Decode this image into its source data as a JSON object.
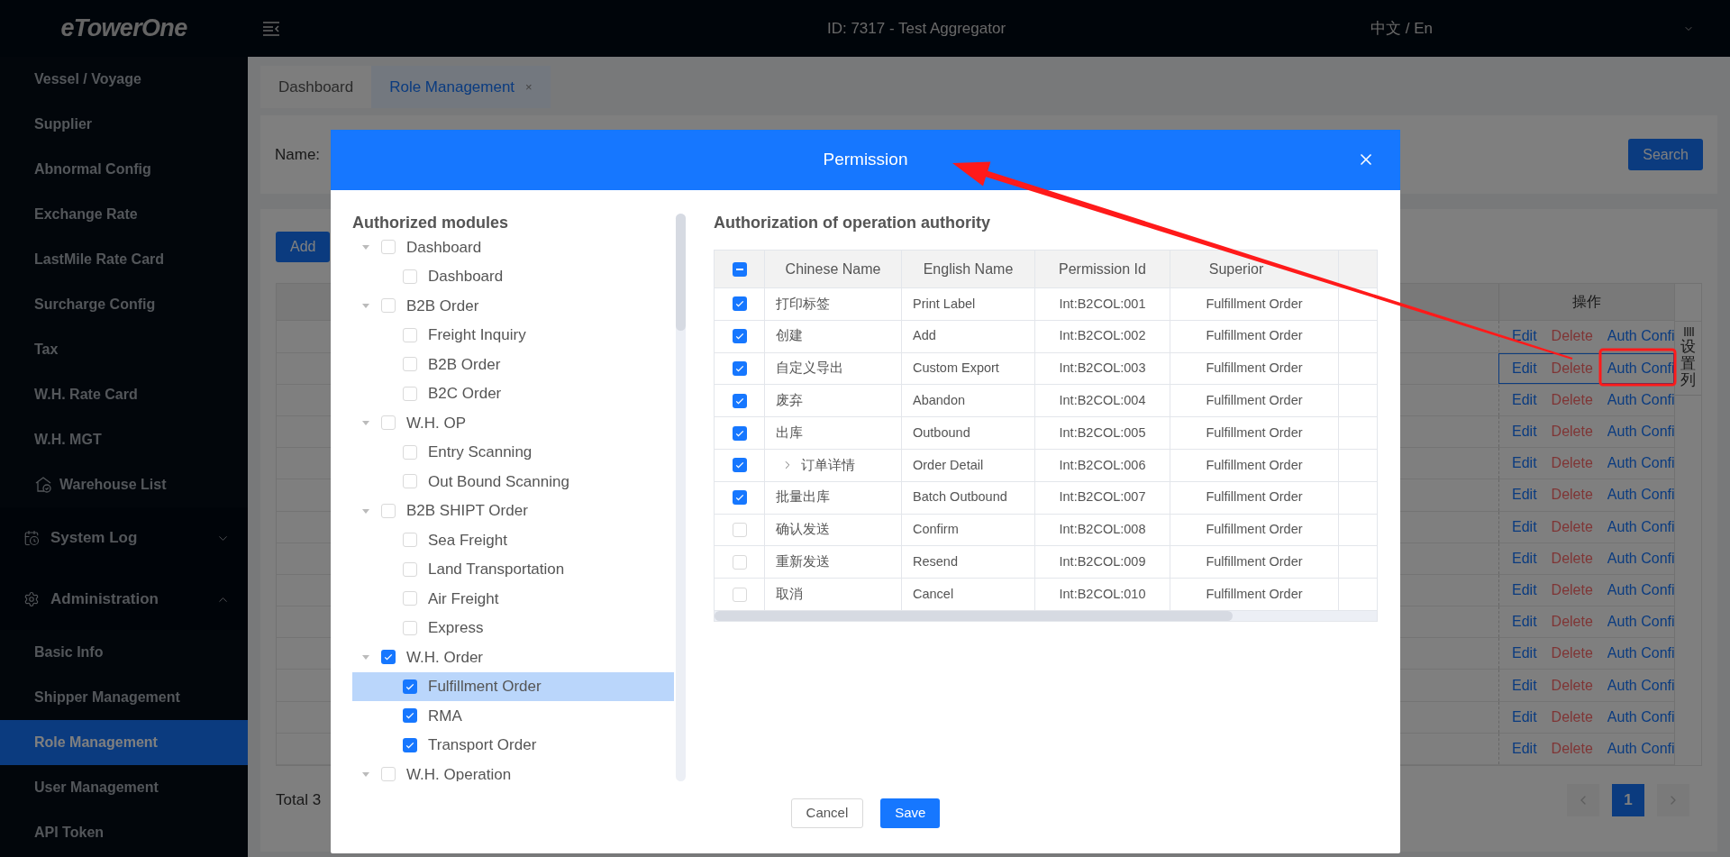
{
  "header": {
    "logo": "eTowerOne",
    "org": "ID: 7317 - Test Aggregator",
    "language": "中文 / En"
  },
  "sidebar": {
    "items": [
      {
        "label": "Vessel / Voyage",
        "kind": "item",
        "selected": false
      },
      {
        "label": "Supplier",
        "kind": "item",
        "selected": false
      },
      {
        "label": "Abnormal Config",
        "kind": "item",
        "selected": false
      },
      {
        "label": "Exchange Rate",
        "kind": "item",
        "selected": false
      },
      {
        "label": "LastMile Rate Card",
        "kind": "item",
        "selected": false
      },
      {
        "label": "Surcharge Config",
        "kind": "item",
        "selected": false
      },
      {
        "label": "Tax",
        "kind": "item",
        "selected": false
      },
      {
        "label": "W.H. Rate Card",
        "kind": "item",
        "selected": false
      },
      {
        "label": "W.H. MGT",
        "kind": "item",
        "selected": false
      },
      {
        "label": "Warehouse List",
        "kind": "icon-item",
        "selected": false
      },
      {
        "label": "System Log",
        "kind": "log-group",
        "expanded": false
      },
      {
        "label": "Administration",
        "kind": "admin-group",
        "expanded": true
      },
      {
        "label": "Basic Info",
        "kind": "item",
        "selected": false
      },
      {
        "label": "Shipper Management",
        "kind": "item",
        "selected": false
      },
      {
        "label": "Role Management",
        "kind": "item",
        "selected": true
      },
      {
        "label": "User Management",
        "kind": "item",
        "selected": false
      },
      {
        "label": "API Token",
        "kind": "item",
        "selected": false
      }
    ]
  },
  "tabs": [
    {
      "label": "Dashboard",
      "selected": false
    },
    {
      "label": "Role Management",
      "selected": true,
      "close": "×"
    }
  ],
  "filter": {
    "label": "Name:",
    "search_button": "Search"
  },
  "list": {
    "add_button": "Add",
    "action_header": "操作",
    "column_settings": "设置列",
    "rows": [
      {
        "highlighted": false,
        "actions": [
          {
            "label": "Edit",
            "kind": "link"
          },
          {
            "label": "Delete",
            "kind": "danger"
          },
          {
            "label": "Auth Confi",
            "kind": "link"
          }
        ]
      },
      {
        "highlighted": true,
        "actions": [
          {
            "label": "Edit",
            "kind": "link"
          },
          {
            "label": "Delete",
            "kind": "danger"
          },
          {
            "label": "Auth Confi",
            "kind": "link"
          }
        ]
      },
      {
        "highlighted": false,
        "actions": [
          {
            "label": "Edit",
            "kind": "link"
          },
          {
            "label": "Delete",
            "kind": "danger"
          },
          {
            "label": "Auth Confi",
            "kind": "link"
          }
        ]
      },
      {
        "highlighted": false,
        "actions": [
          {
            "label": "Edit",
            "kind": "link"
          },
          {
            "label": "Delete",
            "kind": "danger"
          },
          {
            "label": "Auth Confi",
            "kind": "link"
          }
        ]
      },
      {
        "highlighted": false,
        "actions": [
          {
            "label": "Edit",
            "kind": "link"
          },
          {
            "label": "Delete",
            "kind": "danger"
          },
          {
            "label": "Auth Confi",
            "kind": "link"
          }
        ]
      },
      {
        "highlighted": false,
        "actions": [
          {
            "label": "Edit",
            "kind": "link"
          },
          {
            "label": "Delete",
            "kind": "danger"
          },
          {
            "label": "Auth Confi",
            "kind": "link"
          }
        ]
      },
      {
        "highlighted": false,
        "actions": [
          {
            "label": "Edit",
            "kind": "link"
          },
          {
            "label": "Delete",
            "kind": "danger"
          },
          {
            "label": "Auth Confi",
            "kind": "link"
          }
        ]
      },
      {
        "highlighted": false,
        "actions": [
          {
            "label": "Edit",
            "kind": "link"
          },
          {
            "label": "Delete",
            "kind": "danger"
          },
          {
            "label": "Auth Confi",
            "kind": "link"
          }
        ]
      },
      {
        "highlighted": false,
        "actions": [
          {
            "label": "Edit",
            "kind": "link"
          },
          {
            "label": "Delete",
            "kind": "danger"
          },
          {
            "label": "Auth Confi",
            "kind": "link"
          }
        ]
      },
      {
        "highlighted": false,
        "actions": [
          {
            "label": "Edit",
            "kind": "link"
          },
          {
            "label": "Delete",
            "kind": "danger"
          },
          {
            "label": "Auth Confi",
            "kind": "link"
          }
        ]
      },
      {
        "highlighted": false,
        "actions": [
          {
            "label": "Edit",
            "kind": "link"
          },
          {
            "label": "Delete",
            "kind": "danger"
          },
          {
            "label": "Auth Confi",
            "kind": "link"
          }
        ]
      },
      {
        "highlighted": false,
        "actions": [
          {
            "label": "Edit",
            "kind": "link"
          },
          {
            "label": "Delete",
            "kind": "danger"
          },
          {
            "label": "Auth Confi",
            "kind": "link"
          }
        ]
      },
      {
        "highlighted": false,
        "actions": [
          {
            "label": "Edit",
            "kind": "link"
          },
          {
            "label": "Delete",
            "kind": "danger"
          },
          {
            "label": "Auth Confi",
            "kind": "link"
          }
        ]
      },
      {
        "highlighted": false,
        "actions": [
          {
            "label": "Edit",
            "kind": "link"
          },
          {
            "label": "Delete",
            "kind": "danger"
          },
          {
            "label": "Auth Confi",
            "kind": "link"
          }
        ]
      }
    ],
    "total": "Total 3",
    "pages": [
      {
        "label": "1",
        "selected": true
      }
    ]
  },
  "dialog": {
    "title": "Permission",
    "modules": {
      "title": "Authorized modules",
      "tree": [
        {
          "label": "Dashboard",
          "checked": false,
          "expanded": true,
          "selected": false,
          "children": [
            {
              "label": "Dashboard",
              "checked": false,
              "selected": false
            }
          ]
        },
        {
          "label": "B2B Order",
          "checked": false,
          "expanded": true,
          "selected": false,
          "children": [
            {
              "label": "Freight Inquiry",
              "checked": false,
              "selected": false
            },
            {
              "label": "B2B Order",
              "checked": false,
              "selected": false
            },
            {
              "label": "B2C Order",
              "checked": false,
              "selected": false
            }
          ]
        },
        {
          "label": "W.H. OP",
          "checked": false,
          "expanded": true,
          "selected": false,
          "children": [
            {
              "label": "Entry Scanning",
              "checked": false,
              "selected": false
            },
            {
              "label": "Out Bound Scanning",
              "checked": false,
              "selected": false
            }
          ]
        },
        {
          "label": "B2B SHIPT Order",
          "checked": false,
          "expanded": true,
          "selected": false,
          "children": [
            {
              "label": "Sea Freight",
              "checked": false,
              "selected": false
            },
            {
              "label": "Land Transportation",
              "checked": false,
              "selected": false
            },
            {
              "label": "Air Freight",
              "checked": false,
              "selected": false
            },
            {
              "label": "Express",
              "checked": false,
              "selected": false
            }
          ]
        },
        {
          "label": "W.H. Order",
          "checked": true,
          "expanded": true,
          "selected": false,
          "children": [
            {
              "label": "Fulfillment Order",
              "checked": true,
              "selected": true
            },
            {
              "label": "RMA",
              "checked": true,
              "selected": false
            },
            {
              "label": "Transport Order",
              "checked": true,
              "selected": false
            }
          ]
        },
        {
          "label": "W.H. Operation",
          "checked": false,
          "expanded": true,
          "selected": false
        }
      ]
    },
    "operations": {
      "title": "Authorization of operation authority",
      "select_all": {
        "indeterminate": true
      },
      "columns": [
        "Chinese Name",
        "English Name",
        "Permission Id",
        "Superior"
      ],
      "rows": [
        {
          "checked": true,
          "chinese": "打印标签",
          "english": "Print Label",
          "id": "Int:B2COL:001",
          "menu": "Fulfillment Order"
        },
        {
          "checked": true,
          "chinese": "创建",
          "english": "Add",
          "id": "Int:B2COL:002",
          "menu": "Fulfillment Order"
        },
        {
          "checked": true,
          "chinese": "自定义导出",
          "english": "Custom Export",
          "id": "Int:B2COL:003",
          "menu": "Fulfillment Order"
        },
        {
          "checked": true,
          "chinese": "废弃",
          "english": "Abandon",
          "id": "Int:B2COL:004",
          "menu": "Fulfillment Order"
        },
        {
          "checked": true,
          "chinese": "出库",
          "english": "Outbound",
          "id": "Int:B2COL:005",
          "menu": "Fulfillment Order"
        },
        {
          "checked": true,
          "chinese": "订单详情",
          "english": "Order Detail",
          "id": "Int:B2COL:006",
          "menu": "Fulfillment Order",
          "has_children": true
        },
        {
          "checked": true,
          "chinese": "批量出库",
          "english": "Batch Outbound",
          "id": "Int:B2COL:007",
          "menu": "Fulfillment Order"
        },
        {
          "checked": false,
          "chinese": "确认发送",
          "english": "Confirm",
          "id": "Int:B2COL:008",
          "menu": "Fulfillment Order"
        },
        {
          "checked": false,
          "chinese": "重新发送",
          "english": "Resend",
          "id": "Int:B2COL:009",
          "menu": "Fulfillment Order"
        },
        {
          "checked": false,
          "chinese": "取消",
          "english": "Cancel",
          "id": "Int:B2COL:010",
          "menu": "Fulfillment Order"
        }
      ]
    },
    "buttons": [
      {
        "label": "Cancel",
        "kind": "secondary"
      },
      {
        "label": "Save",
        "kind": "primary"
      }
    ]
  }
}
